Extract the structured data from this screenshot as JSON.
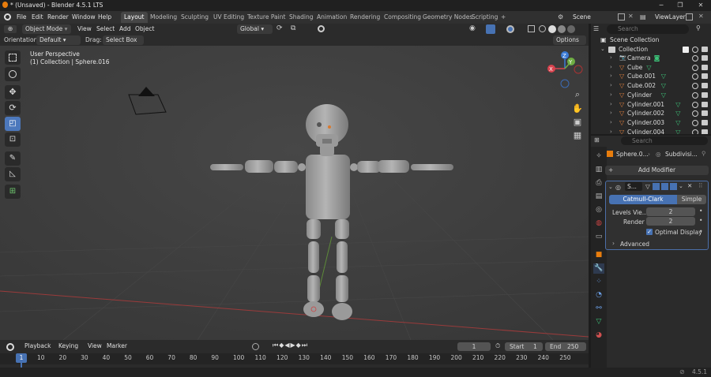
{
  "window": {
    "title": "* (Unsaved) - Blender 4.5.1 LTS"
  },
  "menu": [
    "File",
    "Edit",
    "Render",
    "Window",
    "Help"
  ],
  "workspaces": [
    "Layout",
    "Modeling",
    "Sculpting",
    "UV Editing",
    "Texture Paint",
    "Shading",
    "Animation",
    "Rendering",
    "Compositing",
    "Geometry Nodes",
    "Scripting"
  ],
  "workspace_add": "+",
  "scene": {
    "label": "Scene",
    "viewlayer": "ViewLayer"
  },
  "viewport": {
    "mode": "Object Mode",
    "menus": [
      "View",
      "Select",
      "Add",
      "Object"
    ],
    "orientation_label": "Orientation:",
    "orientation_value": "Default",
    "drag_label": "Drag:",
    "drag_value": "Select Box",
    "transform": "Global",
    "options": "Options",
    "overlay_title": "User Perspective",
    "overlay_sub": "(1) Collection | Sphere.016",
    "gizmo": {
      "x": "X",
      "y": "Y",
      "z": "Z"
    }
  },
  "outliner": {
    "search_placeholder": "Search",
    "root": "Scene Collection",
    "collection": "Collection",
    "items": [
      "Camera",
      "Cube",
      "Cube.001",
      "Cube.002",
      "Cylinder",
      "Cylinder.001",
      "Cylinder.002",
      "Cylinder.003",
      "Cylinder.004"
    ]
  },
  "properties": {
    "search_placeholder": "Search",
    "object": "Sphere.0...",
    "modifier_tab": "Subdivisi...",
    "add_modifier": "Add Modifier",
    "mod_name": "S...",
    "type_catmull": "Catmull-Clark",
    "type_simple": "Simple",
    "levels_label": "Levels Vie...",
    "levels_value": "2",
    "render_label": "Render",
    "render_value": "2",
    "optimal": "Optimal Display",
    "advanced": "Advanced"
  },
  "timeline": {
    "menus": [
      "Playback",
      "Keying",
      "View",
      "Marker"
    ],
    "current_frame": "1",
    "start_label": "Start",
    "start": "1",
    "end_label": "End",
    "end": "250",
    "ticks": [
      "1",
      "10",
      "20",
      "30",
      "40",
      "50",
      "60",
      "70",
      "80",
      "90",
      "100",
      "110",
      "120",
      "130",
      "140",
      "150",
      "160",
      "170",
      "180",
      "190",
      "200",
      "210",
      "220",
      "230",
      "240",
      "250"
    ]
  },
  "status": {
    "version": "4.5.1"
  },
  "colors": {
    "accent": "#4772b3",
    "bg": "#3e3e3e",
    "xaxis": "#c4463e",
    "yaxis": "#6aa13e"
  }
}
